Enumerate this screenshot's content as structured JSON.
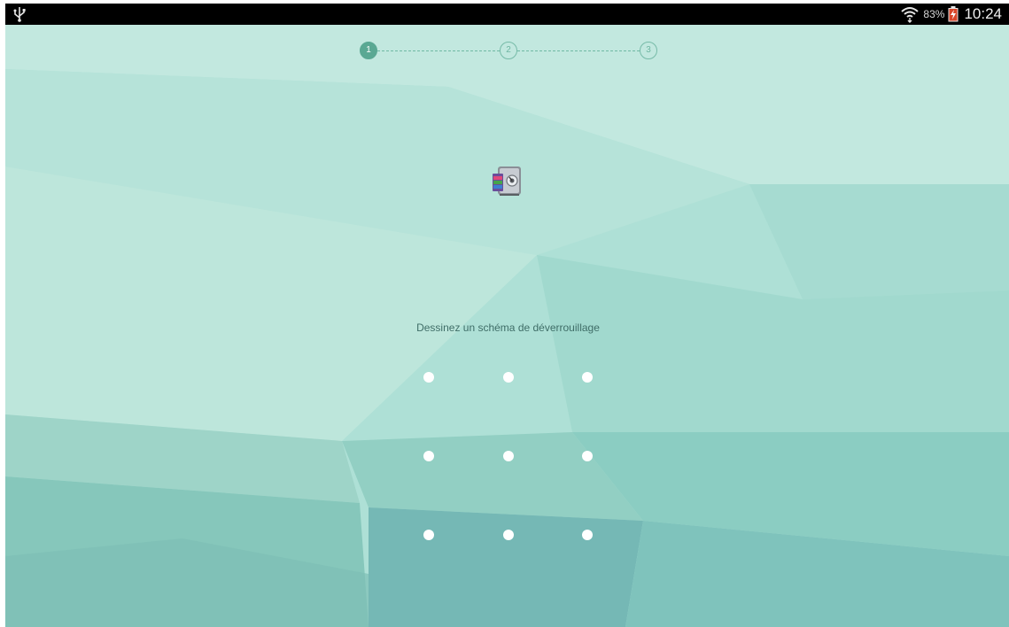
{
  "status_bar": {
    "usb_icon": "usb-icon",
    "wifi_icon": "wifi-icon",
    "battery_percent": "83%",
    "battery_icon": "battery-charging-icon",
    "time": "10:24"
  },
  "steps": [
    {
      "label": "1",
      "state": "active"
    },
    {
      "label": "2",
      "state": "inactive"
    },
    {
      "label": "3",
      "state": "inactive"
    }
  ],
  "app_icon": "vault-app-icon",
  "prompt": "Dessinez un schéma de déverrouillage",
  "pattern": {
    "rows": 3,
    "cols": 3
  },
  "colors": {
    "accent": "#5aa893",
    "background": "#a9ddd3",
    "status_bar": "#000000",
    "prompt_text": "#3f6d67"
  }
}
